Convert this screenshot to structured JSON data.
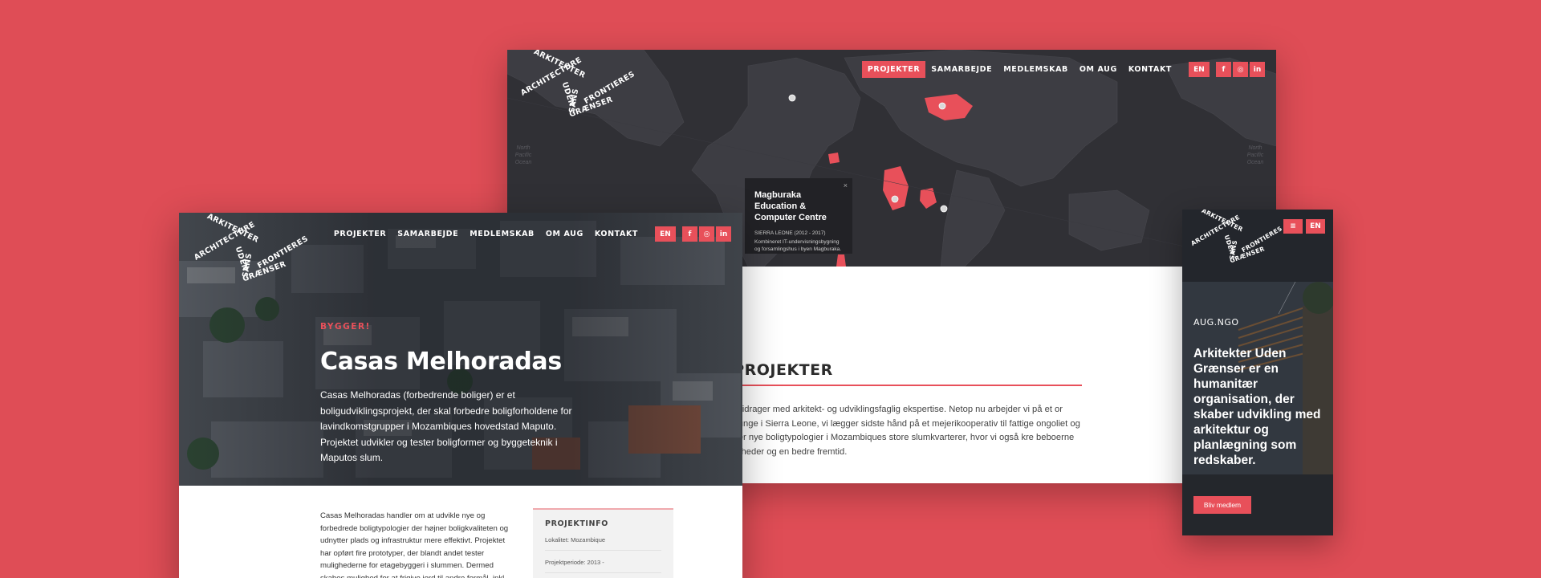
{
  "brand": {
    "logo_lines": [
      "ARKITEKTER",
      "ARCHITECTURE",
      "UDEN",
      "SANS",
      "GRÆNSER",
      "FRONTIERES"
    ],
    "accent": "#e8505a",
    "background": "#df4d56"
  },
  "map_window": {
    "nav": {
      "items": [
        "PROJEKTER",
        "SAMARBEJDE",
        "MEDLEMSKAB",
        "OM AUG",
        "KONTAKT"
      ],
      "active": "PROJEKTER",
      "lang": "EN",
      "social": [
        "f",
        "◎",
        "in"
      ]
    },
    "ocean_left": "North\nPacific\nOcean",
    "ocean_right": "North\nPacific\nOcean",
    "popup": {
      "title": "Magburaka Education & Computer Centre",
      "meta": "SIERRA LEONE (2012 - 2017)",
      "desc": "Kombineret IT-undervisningsbygning og forsamlingshus i byen Magburaka.",
      "close": "×"
    },
    "heading": "LE PROJEKTER",
    "text": "rænser bidrager med arkitekt- og udviklingsfaglig ekspertise. Netop nu arbejder vi på et or udsatte unge i Sierra Leone, vi lægger sidste hånd på et mejerikooperativ til fattige ongoliet og vi udvikler nye boligtypologier i Mozambiques store slumkvarterer, hvor vi også kre beboerne jordrettigheder og en bedre fremtid."
  },
  "desktop_window": {
    "nav": {
      "items": [
        "PROJEKTER",
        "SAMARBEJDE",
        "MEDLEMSKAB",
        "OM AUG",
        "KONTAKT"
      ],
      "lang": "EN",
      "social": [
        "f",
        "◎",
        "in"
      ]
    },
    "hero": {
      "kicker": "BYGGER!",
      "title": "Casas Melhoradas",
      "text": "Casas Melhoradas (forbedrende boliger) er et boligudviklingsprojekt, der skal forbedre boligforholdene for lavindkomstgrupper i Mozambiques hovedstad Maputo. Projektet udvikler og tester boligformer og byggeteknik i Maputos slum."
    },
    "body_text": "Casas Melhoradas handler om at udvikle nye og forbedrede boligtypologier der højner boligkvaliteten og udnytter plads og infrastruktur mere effektivt. Projektet har opført fire prototyper, der blandt andet tester mulighederne for etagebyggeri i slummen. Dermed skabes mulighed for at frigive jord til andre formål, inkl.",
    "info": {
      "title": "PROJEKTINFO",
      "rows": [
        "Lokalitet: Mozambique",
        "Projektperiode: 2013 -"
      ]
    }
  },
  "mobile_window": {
    "menu_icon": "≡",
    "lang": "EN",
    "kicker": "AUG.NGO",
    "headline": "Arkitekter Uden Grænser er en humanitær organisation, der skaber udvikling med arkitektur og planlægning som redskaber.",
    "cta": "Bliv medlem"
  }
}
